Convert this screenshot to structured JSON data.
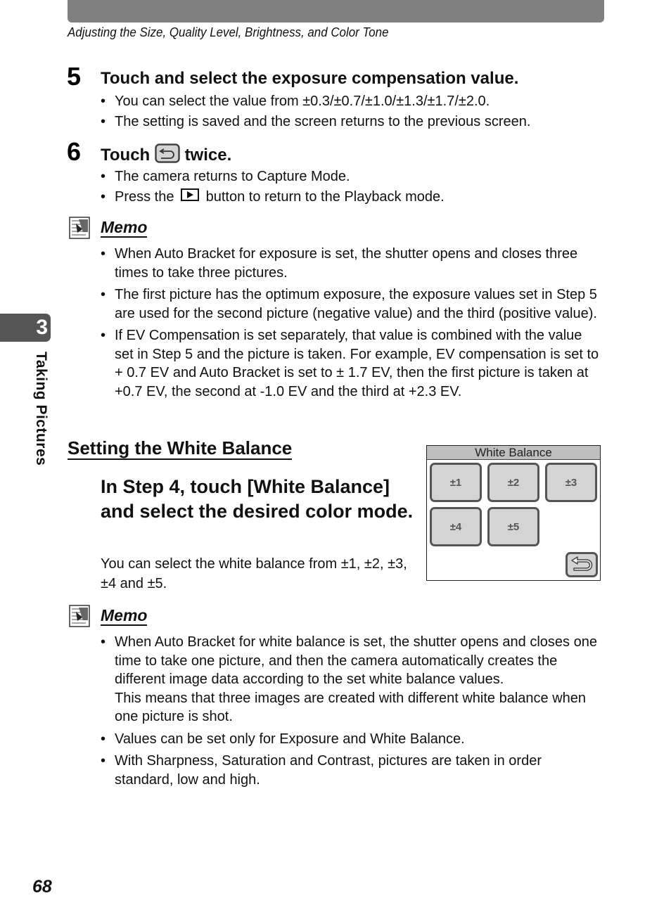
{
  "header": {
    "running_title": "Adjusting the Size, Quality Level, Brightness, and Color Tone"
  },
  "chapter": {
    "number": "3",
    "title": "Taking Pictures"
  },
  "steps": [
    {
      "number": "5",
      "title": "Touch and select the exposure compensation value.",
      "bullets": [
        "You can select the value from ±0.3/±0.7/±1.0/±1.3/±1.7/±2.0.",
        "The setting is saved and the screen returns to the previous screen."
      ]
    },
    {
      "number": "6",
      "title_before_icon": "Touch",
      "title_icon": "back-button-icon",
      "title_after_icon": "twice.",
      "bullets": [
        "The camera returns to Capture Mode.",
        {
          "before_icon": "Press the",
          "icon": "playback-icon",
          "after_icon": "button to return to the Playback mode."
        }
      ]
    }
  ],
  "memo1": {
    "label": "Memo",
    "bullets": [
      "When Auto Bracket for exposure is set, the shutter opens and closes three times to take three pictures.",
      "The first picture has the optimum exposure, the exposure values set in Step 5 are used for the second picture (negative value) and the third (positive value).",
      "If EV Compensation is set separately, that value is combined with the value set in Step 5 and the picture is taken. For example, EV compensation is set to + 0.7 EV and Auto Bracket is set to ± 1.7 EV, then the first picture is taken at +0.7 EV, the second at -1.0 EV and the third at +2.3 EV."
    ]
  },
  "white_balance_section": {
    "title": "Setting the White Balance",
    "heading": "In Step 4, touch [White Balance] and select the desired color mode.",
    "text": "You can select the white balance from ±1, ±2, ±3, ±4 and ±5.",
    "screen": {
      "title": "White Balance",
      "options": [
        "±1",
        "±2",
        "±3",
        "±4",
        "±5"
      ],
      "back_icon": "back-button-icon"
    }
  },
  "memo2": {
    "label": "Memo",
    "bullets": [
      "When Auto Bracket for white balance is set, the shutter opens and closes one time to take one picture, and then the camera automatically creates the different image data according to the set white balance values.\nThis means that three images are created with different white balance when one picture is shot.",
      "Values can be set only for Exposure and White Balance.",
      "With Sharpness, Saturation and Contrast, pictures are taken in order standard, low and high."
    ]
  },
  "footer": {
    "page_number": "68"
  }
}
